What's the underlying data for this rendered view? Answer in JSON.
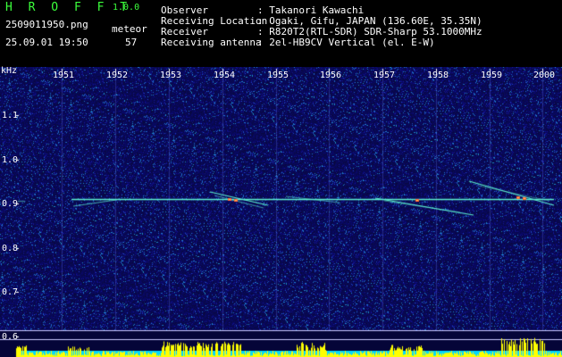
{
  "app": {
    "name": "H R O F F T",
    "version": "1.0.0",
    "filename": "2509011950.png",
    "datetime": "25.09.01 19:50",
    "mode_label": "meteor",
    "meteor_count": "57"
  },
  "info": [
    {
      "label": "Observer",
      "value": ": Takanori Kawachi"
    },
    {
      "label": "Receiving Location",
      "value": ": Ogaki, Gifu, JAPAN (136.60E, 35.35N)"
    },
    {
      "label": "Receiver",
      "value": ": R820T2(RTL-SDR) SDR-Sharp 53.1000MHz"
    },
    {
      "label": "Receiving antenna",
      "value": ": 2el-HB9CV Vertical (el. E-W)"
    }
  ],
  "axis": {
    "y_unit": "kHz",
    "y_ticks": [
      "1.1",
      "1.0",
      "0.9",
      "0.8",
      "0.7",
      "0.6"
    ],
    "x_ticks": [
      "1951",
      "1952",
      "1953",
      "1954",
      "1955",
      "1956",
      "1957",
      "1958",
      "1959",
      "2000"
    ]
  },
  "colors": {
    "background": "#000000",
    "noise_base": "#0a0a6e",
    "signal": "#5cf0d0",
    "hot": "#ff6040",
    "power_trace": "#ffff00",
    "power_base": "#00d8ff",
    "title_green": "#3cff3c"
  }
}
